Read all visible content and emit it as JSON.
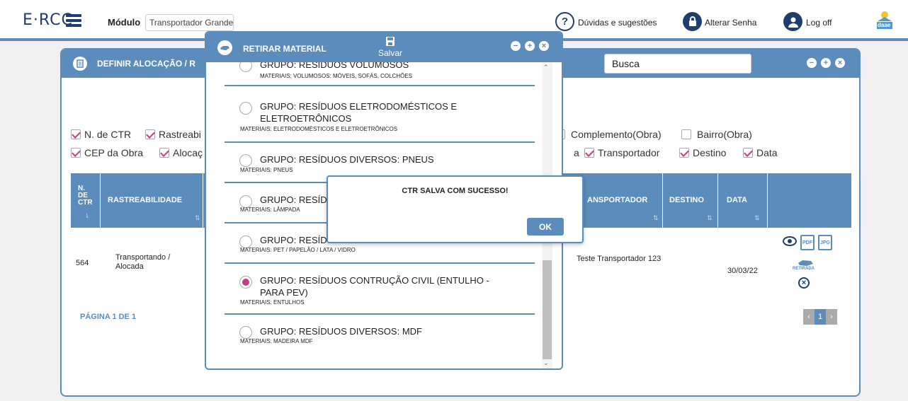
{
  "topbar": {
    "logo": "E·RCC",
    "module_label": "Módulo",
    "module_value": "Transportador Grande",
    "help": "Dúvidas e sugestões",
    "change_password": "Alterar Senha",
    "logoff": "Log off",
    "brand_mini": "daae"
  },
  "panel": {
    "title": "DEFINIR ALOCAÇÃO / R",
    "search_value": "Busca",
    "controls": [
      "−",
      "+",
      "×"
    ],
    "checks_row1": [
      {
        "label": "N. de CTR",
        "checked": true
      },
      {
        "label": "Rastreabi",
        "checked": true
      },
      {
        "label": "Complemento(Obra)",
        "checked": false
      },
      {
        "label": "Bairro(Obra)",
        "checked": false
      }
    ],
    "checks_row2": [
      {
        "label": "CEP da Obra",
        "checked": true
      },
      {
        "label": "Alocaç",
        "checked": true
      },
      {
        "label": "a",
        "checked": null
      },
      {
        "label": "Transportador",
        "checked": true
      },
      {
        "label": "Destino",
        "checked": true
      },
      {
        "label": "Data",
        "checked": true
      }
    ],
    "table": {
      "headers": [
        "N. DE CTR",
        "RASTREABILIDADE",
        "ANSPORTADOR",
        "DESTINO",
        "DATA"
      ],
      "row": {
        "ctr": "564",
        "rastreabilidade": "Transportando / Alocada",
        "transportador": "Teste Transportador 123",
        "destino": "",
        "data": "30/03/22",
        "action_pdf": "PDF",
        "action_jpg": "JPG",
        "action_retirada": "RETIRADA"
      }
    },
    "pagination_text": "PÁGINA 1 DE 1",
    "pager": [
      "‹",
      "1",
      "›"
    ]
  },
  "modal": {
    "title": "RETIRAR MATERIAL",
    "save_label": "Salvar",
    "controls": [
      "−",
      "+",
      "×"
    ],
    "options": [
      {
        "group": "GRUPO: RESÍDUOS VOLUMOSOS",
        "materials": "MATERIAIS: VOLUMOSOS: MÓVEIS, SOFÁS, COLCHÕES",
        "selected": false
      },
      {
        "group": "GRUPO: RESÍDUOS ELETRODOMÉSTICOS E ELETROETRÔNICOS",
        "materials": "MATERIAIS: ELETRODOMÉSTICOS E ELETROETRÔNICOS",
        "selected": false
      },
      {
        "group": "GRUPO: RESÍDUOS DIVERSOS: PNEUS",
        "materials": "MATERIAIS: PNEUS",
        "selected": false
      },
      {
        "group": "GRUPO: RESÍDUO",
        "materials": "MATERIAIS: LÂMPADA",
        "selected": false
      },
      {
        "group": "GRUPO: RESÍDUO",
        "materials": "MATERIAIS: PET / PAPELÃO / LATA / VIDRO",
        "selected": false
      },
      {
        "group": "GRUPO: RESÍDUOS CONTRUÇÃO CIVIL (ENTULHO - PARA PEV)",
        "materials": "MATERIAIS: ENTULHOS",
        "selected": true
      },
      {
        "group": "GRUPO: RESÍDUOS DIVERSOS: MDF",
        "materials": "MATERIAIS: MADEIRA MDF",
        "selected": false
      }
    ]
  },
  "alert": {
    "message": "CTR SALVA COM SUCESSO!",
    "ok_label": "OK"
  },
  "colors": {
    "primary": "#5b8cbc",
    "accent": "#c43b87",
    "navy": "#1e3f6e"
  }
}
